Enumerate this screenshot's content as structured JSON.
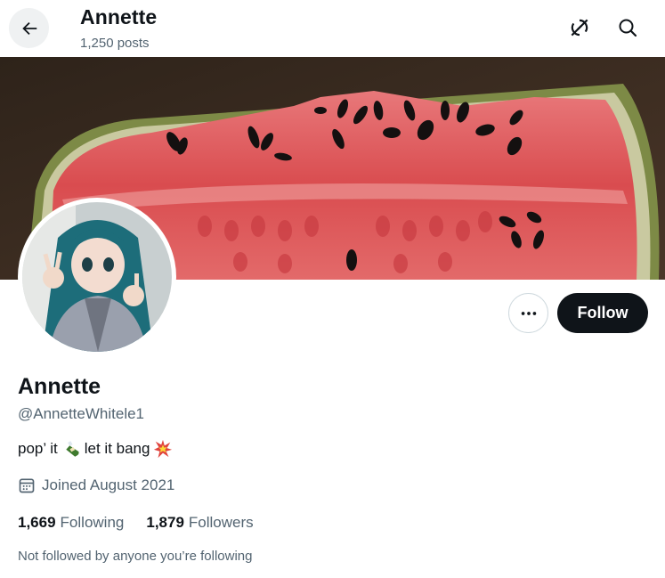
{
  "header": {
    "title": "Annette",
    "posts_count": "1,250 posts",
    "back_icon": "arrow-left-icon",
    "grok_icon": "grok-icon",
    "search_icon": "search-icon"
  },
  "banner": {
    "description_icon": "banner-image"
  },
  "profile": {
    "display_name": "Annette",
    "handle": "@AnnetteWhitele1",
    "bio_part1": "pop’ it",
    "bio_part2": "let it bang",
    "joined": "Joined August 2021",
    "following_count": "1,669",
    "following_label": "Following",
    "followers_count": "1,879",
    "followers_label": "Followers",
    "not_followed": "Not followed by anyone you’re following"
  },
  "actions": {
    "follow_label": "Follow",
    "more_icon": "more-dots-icon"
  },
  "colors": {
    "primary_text": "#0f1419",
    "secondary_text": "#536471",
    "button_dark": "#0f1419",
    "border": "#cfd9de"
  }
}
